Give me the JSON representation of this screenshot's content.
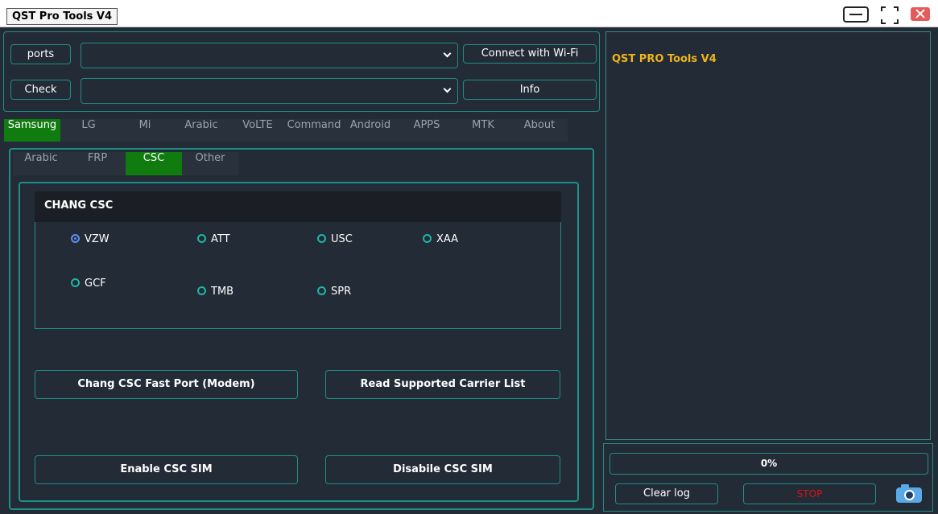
{
  "window": {
    "title": "QST Pro Tools V4"
  },
  "connection": {
    "ports_label": "ports",
    "check_label": "Check",
    "port_select_value": "",
    "device_select_value": "",
    "wifi_label": "Connect with Wi-Fi",
    "info_label": "Info"
  },
  "main_tabs": [
    {
      "label": "Samsung",
      "active": true
    },
    {
      "label": "LG"
    },
    {
      "label": "Mi"
    },
    {
      "label": "Arabic"
    },
    {
      "label": "VoLTE"
    },
    {
      "label": "Command"
    },
    {
      "label": "Android"
    },
    {
      "label": "APPS"
    },
    {
      "label": "MTK"
    },
    {
      "label": "About"
    }
  ],
  "sub_tabs": [
    {
      "label": "Arabic"
    },
    {
      "label": "FRP"
    },
    {
      "label": "CSC",
      "active": true
    },
    {
      "label": "Other"
    }
  ],
  "csc_group": {
    "title": "CHANG CSC",
    "options": [
      {
        "label": "VZW",
        "checked": true
      },
      {
        "label": "ATT"
      },
      {
        "label": "USC"
      },
      {
        "label": "XAA"
      },
      {
        "label": "GCF"
      },
      {
        "label": "TMB"
      },
      {
        "label": "SPR"
      }
    ]
  },
  "actions": {
    "fast_port_label": "Chang CSC Fast Port (Modem)",
    "read_carrier_label": "Read Supported Carrier List",
    "enable_sim_label": "Enable CSC SIM",
    "disable_sim_label": "Disabile CSC SIM"
  },
  "log": {
    "app_name": "QST PRO Tools V4"
  },
  "progress": {
    "value_percent": 0,
    "text": "0%"
  },
  "controls": {
    "clear_log_label": "Clear log",
    "stop_label": "STOP"
  },
  "icons": {
    "screenshot": "camera-icon"
  },
  "colors": {
    "accent": "#1f8f86",
    "active_tab": "#107c10",
    "title_text": "#f0b41a",
    "stop_text": "#e01010",
    "background": "#222b36"
  }
}
